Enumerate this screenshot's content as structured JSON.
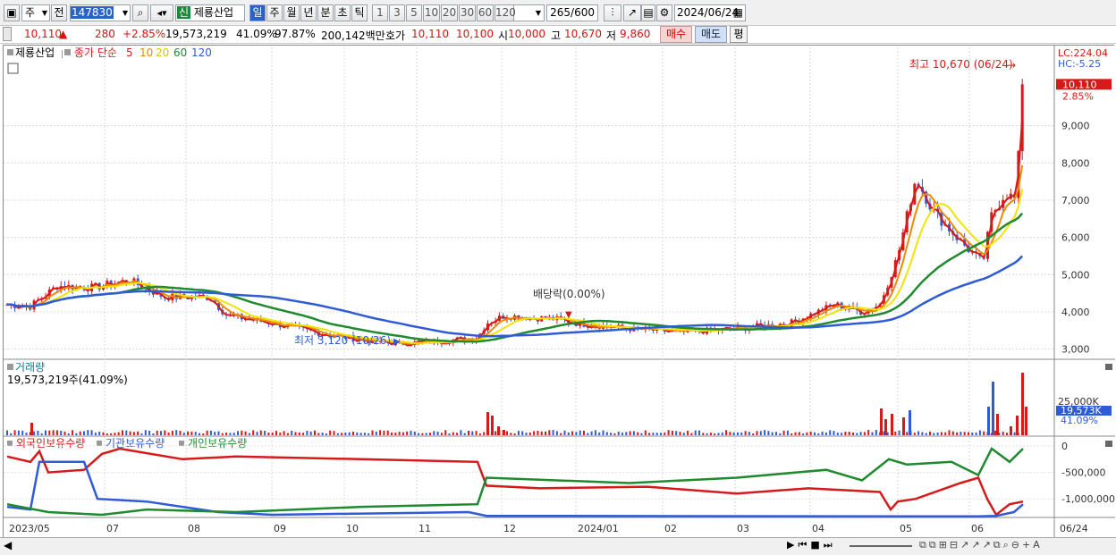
{
  "toolbar": {
    "period_select": "주",
    "prev_label": "전",
    "code": "147830",
    "new_badge": "신",
    "stock_name": "제룡산업",
    "periods": [
      "일",
      "주",
      "월",
      "년",
      "분",
      "초",
      "틱"
    ],
    "intervals": [
      "1",
      "3",
      "5",
      "10",
      "20",
      "30",
      "60",
      "120"
    ],
    "count": "265",
    "count_total": "/600",
    "date": "2024/06/24"
  },
  "quote": {
    "price": "10,110",
    "change": "280",
    "change_pct": "+2.85%",
    "volume": "19,573,219",
    "turnover_pct": "41.09%",
    "ratio": "97.87%",
    "amount": "200,142백만",
    "bid_label": "호가",
    "bid1": "10,110",
    "bid2": "10,100",
    "open_label": "시",
    "open": "10,000",
    "high_label": "고",
    "high": "10,670",
    "low_label": "저",
    "low": "9,860",
    "buy_label": "매수",
    "sell_label": "매도",
    "avg_label": "평"
  },
  "price_panel": {
    "stock_label": "제룡산업",
    "ma_prefix": "종가 단순",
    "ma_periods": [
      "5",
      "10",
      "20",
      "60",
      "120"
    ],
    "ma_colors": [
      "#d61a1a",
      "#ef8a00",
      "#f2e300",
      "#1f8a2e",
      "#2f5bd6"
    ],
    "lc": "LC:224.04",
    "hc": "HC:-5.25",
    "high_note": "최고 10,670 (06/24)",
    "low_note": "최저 3,120 (10/26)",
    "dividend_note": "배당락(0.00%)",
    "last_price": "10,110",
    "last_pct": "2.85%",
    "y_ticks": [
      "9,000",
      "8,000",
      "7,000",
      "6,000",
      "5,000",
      "4,000",
      "3,000"
    ]
  },
  "volume_panel": {
    "title": "거래량",
    "value": "19,573,219주(41.09%)",
    "tick": "25,000K",
    "last": "19,573K",
    "last_pct": "41.09%"
  },
  "holding_panel": {
    "legend": [
      "외국인보유수량",
      "기관보유수량",
      "개인보유수량"
    ],
    "colors": [
      "#d61a1a",
      "#2f5bd6",
      "#1f8a2e"
    ],
    "y_ticks": [
      "0",
      "-500,000",
      "-1,000,000"
    ]
  },
  "x_axis": [
    "2023/05",
    "07",
    "08",
    "09",
    "10",
    "11",
    "12",
    "2024/01",
    "02",
    "03",
    "04",
    "05",
    "06"
  ],
  "x_last": "06/24",
  "chart_data": {
    "type": "candlestick",
    "title": "제룡산업",
    "ylim": [
      2800,
      11000
    ],
    "high": {
      "value": 10670,
      "date": "06/24"
    },
    "low": {
      "value": 3120,
      "date": "10/26"
    },
    "close_points": [
      [
        "2023/05",
        4200
      ],
      [
        "2023/06",
        4650
      ],
      [
        "2023/07",
        4700
      ],
      [
        "2023/08",
        4400
      ],
      [
        "2023/09",
        3600
      ],
      [
        "2023/10",
        3300
      ],
      [
        "2023/11",
        3350
      ],
      [
        "2023/12",
        3900
      ],
      [
        "2024/01",
        3650
      ],
      [
        "2024/02",
        3450
      ],
      [
        "2024/03",
        3600
      ],
      [
        "2024/04",
        4100
      ],
      [
        "2024/05",
        7600
      ],
      [
        "2024/06/10",
        5300
      ],
      [
        "2024/06/24",
        10110
      ]
    ]
  }
}
